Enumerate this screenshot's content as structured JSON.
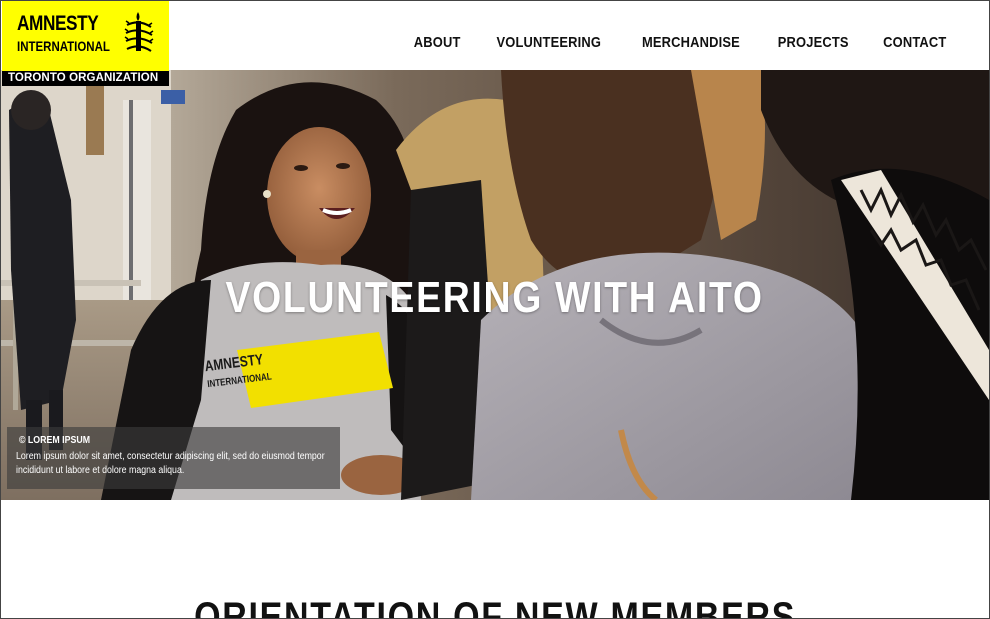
{
  "logo": {
    "line1": "AMNESTY",
    "line2": "INTERNATIONAL",
    "org": "TORONTO ORGANIZATION"
  },
  "nav": {
    "items": [
      {
        "label": "ABOUT"
      },
      {
        "label": "VOLUNTEERING"
      },
      {
        "label": "MERCHANDISE"
      },
      {
        "label": "PROJECTS"
      },
      {
        "label": "CONTACT"
      }
    ]
  },
  "hero": {
    "title": "VOLUNTEERING WITH AITO",
    "shirt_text_line1": "AMNESTY",
    "shirt_text_line2": "INTERNATIONAL",
    "caption": {
      "title": "© LOREM IPSUM",
      "text": "Lorem ipsum dolor sit amet, consectetur adipiscing elit, sed do eiusmod tempor incididunt ut labore et dolore magna aliqua."
    }
  },
  "section": {
    "title": "ORIENTATION OF NEW MEMBERS"
  },
  "colors": {
    "brand_yellow": "#ffff00",
    "text_dark": "#111111",
    "caption_bg": "rgba(60,60,60,0.62)"
  }
}
